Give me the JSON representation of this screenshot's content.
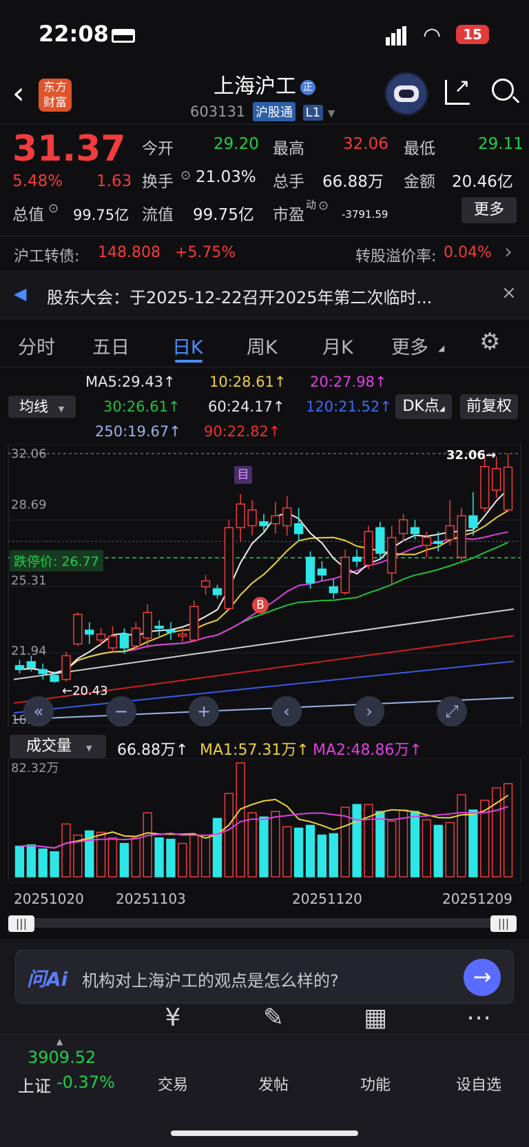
{
  "status": {
    "time": "22:08",
    "battery": "15"
  },
  "header": {
    "title": "上海沪工",
    "code": "603131",
    "tag1": "沪股通",
    "tag2": "L1",
    "logo_line1": "东方",
    "logo_line2": "财富"
  },
  "quote": {
    "price": "31.37",
    "pct": "5.48%",
    "change": "1.63",
    "rows": [
      [
        {
          "l": "今开",
          "v": "29.20",
          "c": "green"
        },
        {
          "l": "最高",
          "v": "32.06",
          "c": "red"
        },
        {
          "l": "最低",
          "v": "29.11",
          "c": "green"
        }
      ],
      [
        {
          "l": "换手",
          "v": "21.03%",
          "c": "white"
        },
        {
          "l": "总手",
          "v": "66.88万",
          "c": "white"
        },
        {
          "l": "金额",
          "v": "20.46亿",
          "c": "white"
        }
      ]
    ],
    "total_label": "总值",
    "total_value": "99.75亿",
    "float_label": "流值",
    "float_value": "99.75亿",
    "pe_label": "市盈",
    "pe_sup": "动",
    "pe_value": "-3791.59",
    "more": "更多"
  },
  "bond": {
    "label": "沪工转债:",
    "price": "148.808",
    "pct": "+5.75%",
    "premium_label": "转股溢价率:",
    "premium_value": "0.04%"
  },
  "notice": {
    "text": "股东大会：于2025-12-22召开2025年第二次临时..."
  },
  "tabs": [
    "分时",
    "五日",
    "日K",
    "周K",
    "月K",
    "更多"
  ],
  "ma": {
    "selector": "均线",
    "items": [
      {
        "t": "MA5:29.43↑",
        "c": "#e8e8e8"
      },
      {
        "t": "10:28.61↑",
        "c": "#f0d23a"
      },
      {
        "t": "20:27.98↑",
        "c": "#e040e0"
      },
      {
        "t": "30:26.61↑",
        "c": "#22c23a"
      },
      {
        "t": "60:24.17↑",
        "c": "#e8e8e8"
      },
      {
        "t": "120:21.52↑",
        "c": "#3a6cff"
      },
      {
        "t": "250:19.67↑",
        "c": "#9ab4e6"
      },
      {
        "t": "90:22.82↑",
        "c": "#ee3030"
      }
    ],
    "dk": "DK点",
    "fq": "前复权"
  },
  "kline": {
    "ymax": "32.06",
    "ymid": "28.69",
    "ylow": "25.31",
    "ymin2": "21.94",
    "ybottom": "18.56",
    "limit_label": "跌停价:",
    "limit_value": "26.77",
    "high_marker": "32.06",
    "low_marker": "20.43",
    "mark_mu": "目",
    "mark_b": "B"
  },
  "chart_data": {
    "type": "candlestick",
    "ylim": [
      18.56,
      32.06
    ],
    "candles": [
      {
        "o": 21.3,
        "c": 21.1,
        "h": 21.6,
        "l": 20.9
      },
      {
        "o": 21.5,
        "c": 21.2,
        "h": 21.8,
        "l": 21.0
      },
      {
        "o": 21.1,
        "c": 20.9,
        "h": 21.4,
        "l": 20.6
      },
      {
        "o": 20.8,
        "c": 20.5,
        "h": 21.0,
        "l": 20.43
      },
      {
        "o": 20.6,
        "c": 21.8,
        "h": 22.0,
        "l": 20.5
      },
      {
        "o": 22.4,
        "c": 23.9,
        "h": 24.0,
        "l": 22.3
      },
      {
        "o": 23.1,
        "c": 22.9,
        "h": 23.5,
        "l": 22.4
      },
      {
        "o": 22.6,
        "c": 22.9,
        "h": 23.2,
        "l": 22.3
      },
      {
        "o": 22.2,
        "c": 22.8,
        "h": 23.3,
        "l": 22.0
      },
      {
        "o": 22.9,
        "c": 22.2,
        "h": 23.2,
        "l": 21.9
      },
      {
        "o": 22.3,
        "c": 23.2,
        "h": 23.5,
        "l": 22.2
      },
      {
        "o": 22.7,
        "c": 24.0,
        "h": 24.4,
        "l": 22.2
      },
      {
        "o": 23.3,
        "c": 23.2,
        "h": 23.6,
        "l": 22.8
      },
      {
        "o": 23.1,
        "c": 23.0,
        "h": 23.5,
        "l": 22.6
      },
      {
        "o": 22.8,
        "c": 22.9,
        "h": 23.2,
        "l": 22.5
      },
      {
        "o": 22.6,
        "c": 24.3,
        "h": 24.6,
        "l": 22.5
      },
      {
        "o": 25.3,
        "c": 25.6,
        "h": 25.9,
        "l": 24.9
      },
      {
        "o": 25.2,
        "c": 24.9,
        "h": 25.4,
        "l": 24.7
      },
      {
        "o": 24.2,
        "c": 28.3,
        "h": 28.7,
        "l": 24.1
      },
      {
        "o": 28.3,
        "c": 29.5,
        "h": 30.0,
        "l": 27.6
      },
      {
        "o": 28.4,
        "c": 29.2,
        "h": 29.7,
        "l": 27.9
      },
      {
        "o": 28.6,
        "c": 28.4,
        "h": 29.0,
        "l": 28.0
      },
      {
        "o": 28.5,
        "c": 28.9,
        "h": 29.6,
        "l": 28.0
      },
      {
        "o": 28.4,
        "c": 29.3,
        "h": 29.9,
        "l": 27.9
      },
      {
        "o": 28.5,
        "c": 28.0,
        "h": 29.3,
        "l": 27.6
      },
      {
        "o": 26.8,
        "c": 25.5,
        "h": 27.1,
        "l": 25.2
      },
      {
        "o": 26.2,
        "c": 25.9,
        "h": 26.6,
        "l": 25.6
      },
      {
        "o": 25.3,
        "c": 25.0,
        "h": 25.7,
        "l": 24.7
      },
      {
        "o": 25.0,
        "c": 26.8,
        "h": 27.2,
        "l": 24.9
      },
      {
        "o": 26.8,
        "c": 26.6,
        "h": 27.2,
        "l": 26.3
      },
      {
        "o": 26.4,
        "c": 28.1,
        "h": 28.4,
        "l": 26.2
      },
      {
        "o": 28.3,
        "c": 27.0,
        "h": 28.6,
        "l": 26.7
      },
      {
        "o": 26.0,
        "c": 27.8,
        "h": 28.4,
        "l": 25.4
      },
      {
        "o": 28.0,
        "c": 28.7,
        "h": 29.0,
        "l": 27.6
      },
      {
        "o": 28.3,
        "c": 28.0,
        "h": 28.7,
        "l": 27.7
      },
      {
        "o": 27.4,
        "c": 27.8,
        "h": 28.1,
        "l": 26.8
      },
      {
        "o": 27.6,
        "c": 27.5,
        "h": 28.1,
        "l": 27.1
      },
      {
        "o": 27.7,
        "c": 28.4,
        "h": 29.7,
        "l": 27.4
      },
      {
        "o": 26.8,
        "c": 28.9,
        "h": 29.3,
        "l": 26.6
      },
      {
        "o": 28.9,
        "c": 28.3,
        "h": 30.1,
        "l": 27.9
      },
      {
        "o": 29.3,
        "c": 31.4,
        "h": 31.9,
        "l": 29.1
      },
      {
        "o": 30.2,
        "c": 31.3,
        "h": 31.9,
        "l": 29.8
      },
      {
        "o": 29.2,
        "c": 31.37,
        "h": 32.06,
        "l": 29.11
      }
    ],
    "volume_ymax": 82.32,
    "volumes": [
      22,
      23,
      20,
      18,
      38,
      30,
      33,
      32,
      28,
      24,
      28,
      46,
      28,
      27,
      24,
      30,
      30,
      42,
      60,
      82,
      46,
      43,
      47,
      36,
      35,
      37,
      30,
      31,
      50,
      52,
      52,
      47,
      40,
      48,
      47,
      41,
      37,
      39,
      59,
      48,
      55,
      64,
      67
    ],
    "volume_ma1": 57.31,
    "volume_ma2": 48.86,
    "x_labels": [
      "20251020",
      "20251103",
      "20251120",
      "20251209"
    ]
  },
  "volume": {
    "selector": "成交量",
    "value": "66.88万↑",
    "ma1": "MA1:57.31万↑",
    "ma2": "MA2:48.86万↑",
    "ymax": "82.32万"
  },
  "ai": {
    "logo": "问Ai",
    "placeholder": "机构对上海沪工的观点是怎么样的?"
  },
  "index": {
    "value": "3909.52",
    "name": "上证",
    "pct": "-0.37%"
  },
  "nav": [
    {
      "label": "交易",
      "icon": "¥"
    },
    {
      "label": "发帖",
      "icon": "✎"
    },
    {
      "label": "功能",
      "icon": "▦"
    },
    {
      "label": "设自选",
      "icon": "⋯"
    }
  ]
}
